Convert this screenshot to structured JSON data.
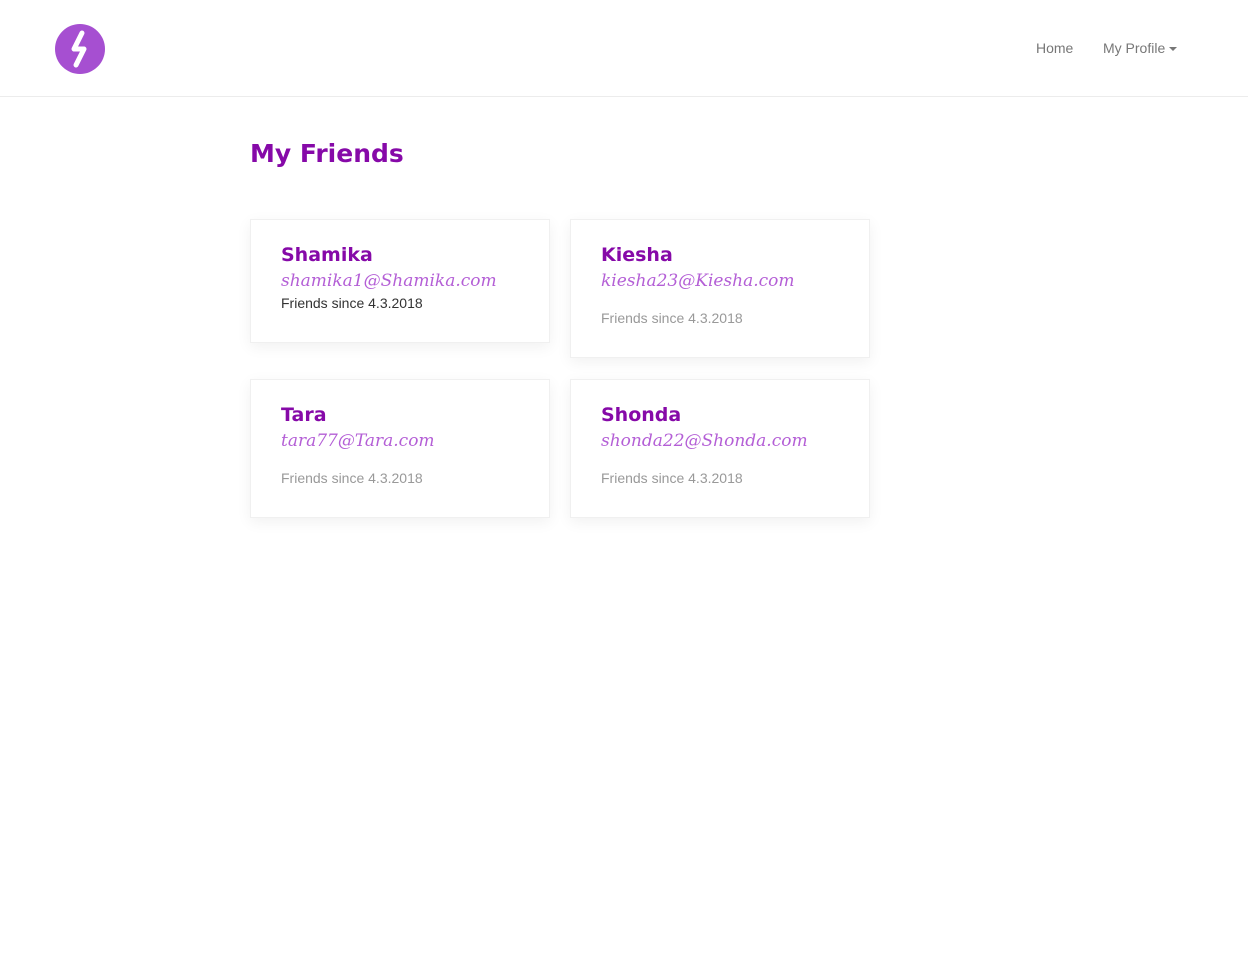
{
  "navbar": {
    "logo_icon": "s-logo-icon",
    "logo_color": "#a64fd1",
    "links": [
      {
        "label": "Home"
      },
      {
        "label": "My Profile"
      }
    ]
  },
  "main": {
    "title": "My Friends",
    "friends": [
      {
        "name": "Shamika",
        "email": "shamika1@Shamika.com",
        "since": "Friends since 4.3.2018"
      },
      {
        "name": "Kiesha",
        "email": "kiesha23@Kiesha.com",
        "since": "Friends since 4.3.2018"
      },
      {
        "name": "Tara",
        "email": "tara77@Tara.com",
        "since": "Friends since 4.3.2018"
      },
      {
        "name": "Shonda",
        "email": "shonda22@Shonda.com",
        "since": "Friends since 4.3.2018"
      }
    ]
  },
  "colors": {
    "brand": "#8609a8",
    "email": "#b45fd6",
    "muted": "#999999"
  }
}
